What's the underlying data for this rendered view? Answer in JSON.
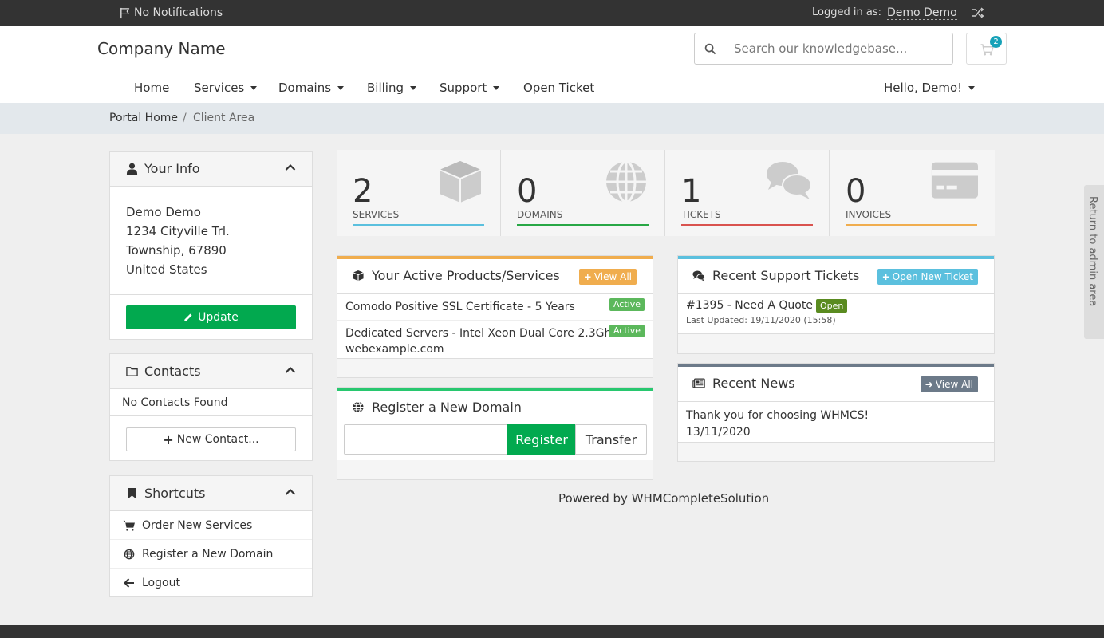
{
  "topbar": {
    "notifications": "No Notifications",
    "logged_in_label": "Logged in as:",
    "user": "Demo Demo"
  },
  "header": {
    "brand": "Company Name",
    "search_placeholder": "Search our knowledgebase...",
    "cart_count": "2"
  },
  "nav": {
    "home": "Home",
    "services": "Services",
    "domains": "Domains",
    "billing": "Billing",
    "support": "Support",
    "open_ticket": "Open Ticket",
    "hello": "Hello, Demo!"
  },
  "breadcrumb": {
    "home": "Portal Home",
    "separator": "/",
    "current": "Client Area"
  },
  "your_info": {
    "title": "Your Info",
    "name": "Demo Demo",
    "address1": "1234 Cityville Trl.",
    "address2": "Township, 67890",
    "country": "United States",
    "update_label": "Update"
  },
  "contacts": {
    "title": "Contacts",
    "empty": "No Contacts Found",
    "new_label": "New Contact..."
  },
  "shortcuts": {
    "title": "Shortcuts",
    "items": [
      "Order New Services",
      "Register a New Domain",
      "Logout"
    ]
  },
  "stats": [
    {
      "value": "2",
      "label": "SERVICES",
      "color": "#5bc0de",
      "icon": "cube-icon"
    },
    {
      "value": "0",
      "label": "DOMAINS",
      "color": "#28a745",
      "icon": "globe-icon"
    },
    {
      "value": "1",
      "label": "TICKETS",
      "color": "#d9534f",
      "icon": "comments-icon"
    },
    {
      "value": "0",
      "label": "INVOICES",
      "color": "#f0ad4e",
      "icon": "credit-card-icon"
    }
  ],
  "products": {
    "title": "Your Active Products/Services",
    "view_all": "View All",
    "items": [
      {
        "name": "Comodo Positive SSL Certificate - 5 Years",
        "status": "Active"
      },
      {
        "name": "Dedicated Servers - Intel Xeon Dual Core 2.3Ghz",
        "domain": "webexample.com",
        "status": "Active"
      }
    ]
  },
  "register_domain": {
    "title": "Register a New Domain",
    "register_label": "Register",
    "transfer_label": "Transfer"
  },
  "tickets": {
    "title": "Recent Support Tickets",
    "open_new": "Open New Ticket",
    "items": [
      {
        "subject": "#1395 - Need A Quote",
        "status": "Open",
        "updated": "Last Updated: 19/11/2020 (15:58)"
      }
    ]
  },
  "news": {
    "title": "Recent News",
    "view_all": "View All",
    "items": [
      {
        "title": "Thank you for choosing WHMCS!",
        "date": "13/11/2020"
      }
    ]
  },
  "powered_by": "Powered by WHMCompleteSolution",
  "admin_tab": "Return to admin area",
  "colors": {
    "green": "#02a94f",
    "orange": "#f0ad4e",
    "info": "#5bc0de",
    "grey": "#6c7a89"
  }
}
